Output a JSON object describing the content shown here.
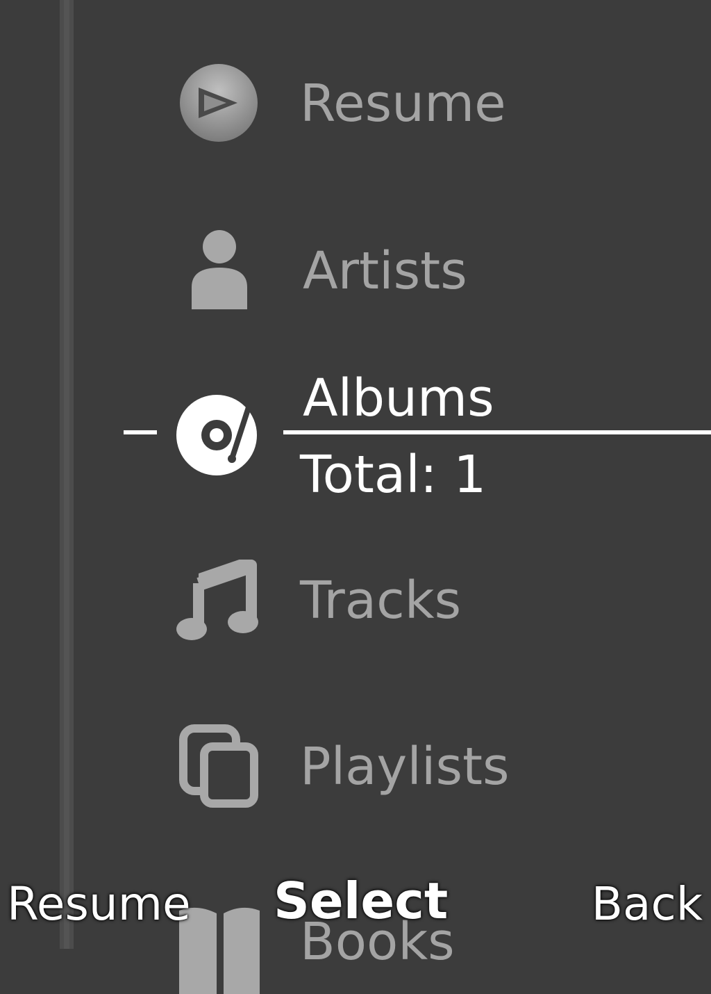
{
  "menu": {
    "items": [
      {
        "label": "Resume",
        "icon": "play-icon"
      },
      {
        "label": "Artists",
        "icon": "person-icon"
      },
      {
        "label": "Albums",
        "icon": "disc-icon",
        "sub": "Total: 1",
        "selected": true
      },
      {
        "label": "Tracks",
        "icon": "music-note-icon"
      },
      {
        "label": "Playlists",
        "icon": "playlists-icon"
      },
      {
        "label": "Books",
        "icon": "book-icon"
      }
    ]
  },
  "softkeys": {
    "left": "Resume",
    "middle": "Select",
    "right": "Back"
  },
  "colors": {
    "background": "#3c3c3c",
    "inactive": "#a4a4a4",
    "active": "#ffffff"
  }
}
